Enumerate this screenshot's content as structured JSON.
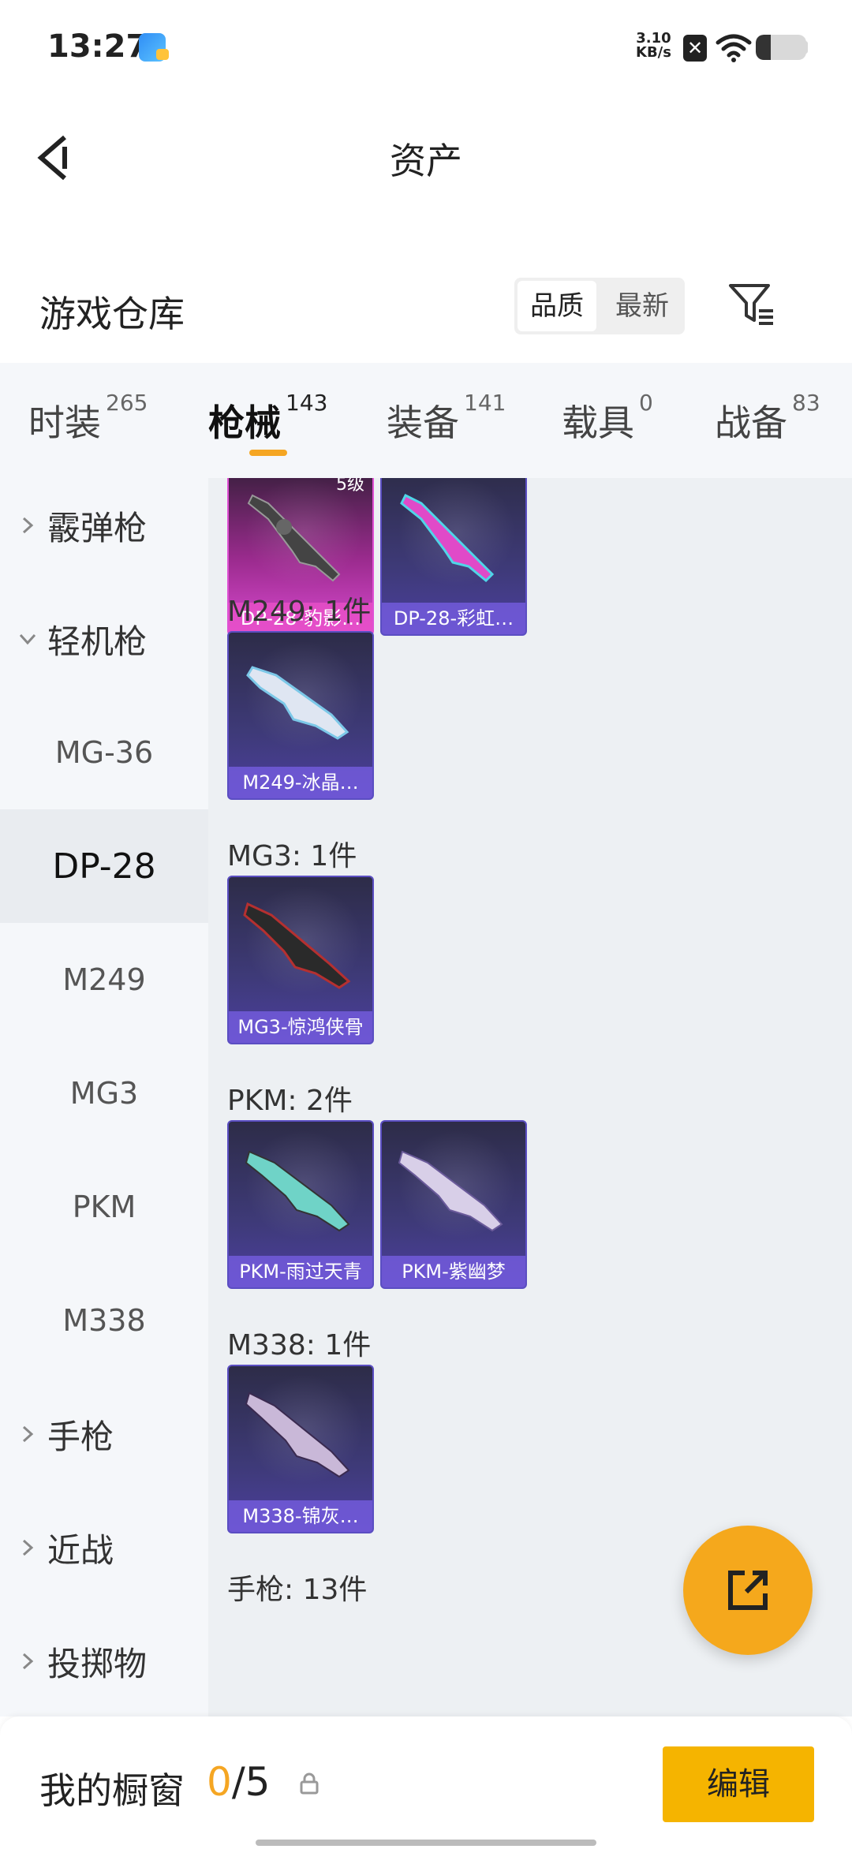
{
  "status": {
    "time": "13:27",
    "net_speed_value": "3.10",
    "net_speed_unit": "KB/s",
    "battery_level": 0.3
  },
  "header": {
    "title": "资产"
  },
  "warehouse": {
    "title": "游戏仓库",
    "sort_options": [
      "品质",
      "最新"
    ],
    "active_sort": "品质"
  },
  "tabs": [
    {
      "label": "时装",
      "count": "265"
    },
    {
      "label": "枪械",
      "count": "143"
    },
    {
      "label": "装备",
      "count": "141"
    },
    {
      "label": "载具",
      "count": "0"
    },
    {
      "label": "战备",
      "count": "83"
    }
  ],
  "sidebar": {
    "items": [
      {
        "label": "霰弹枪",
        "type": "category",
        "expanded": false
      },
      {
        "label": "轻机枪",
        "type": "category",
        "expanded": true
      },
      {
        "label": "MG-36",
        "type": "sub"
      },
      {
        "label": "DP-28",
        "type": "sub",
        "selected": true
      },
      {
        "label": "M249",
        "type": "sub"
      },
      {
        "label": "MG3",
        "type": "sub"
      },
      {
        "label": "PKM",
        "type": "sub"
      },
      {
        "label": "M338",
        "type": "sub"
      },
      {
        "label": "手枪",
        "type": "category",
        "expanded": false
      },
      {
        "label": "近战",
        "type": "category",
        "expanded": false
      },
      {
        "label": "投掷物",
        "type": "category",
        "expanded": false
      }
    ]
  },
  "content": {
    "groups": [
      {
        "label": "",
        "items": [
          {
            "name": "DP-28-豹影…",
            "level": "5级",
            "rarity": "pink"
          },
          {
            "name": "DP-28-彩虹…",
            "rarity": "purple"
          }
        ]
      },
      {
        "label": "M249: 1件",
        "items": [
          {
            "name": "M249-冰晶…",
            "rarity": "purple"
          }
        ]
      },
      {
        "label": "MG3: 1件",
        "items": [
          {
            "name": "MG3-惊鸿侠骨",
            "rarity": "purple"
          }
        ]
      },
      {
        "label": "PKM: 2件",
        "items": [
          {
            "name": "PKM-雨过天青",
            "rarity": "purple"
          },
          {
            "name": "PKM-紫幽梦",
            "rarity": "purple"
          }
        ]
      },
      {
        "label": "M338: 1件",
        "items": [
          {
            "name": "M338-锦灰…",
            "rarity": "purple"
          }
        ]
      },
      {
        "label": "手枪: 13件",
        "items": []
      }
    ]
  },
  "bottom": {
    "showcase_label": "我的橱窗",
    "showcase_current": "0",
    "showcase_total": "/5",
    "edit_label": "编辑"
  },
  "colors": {
    "accent": "#f5a623",
    "edit_button": "#f5b400",
    "rarity_purple": "#5b4ec2",
    "rarity_pink": "#e050d4"
  }
}
